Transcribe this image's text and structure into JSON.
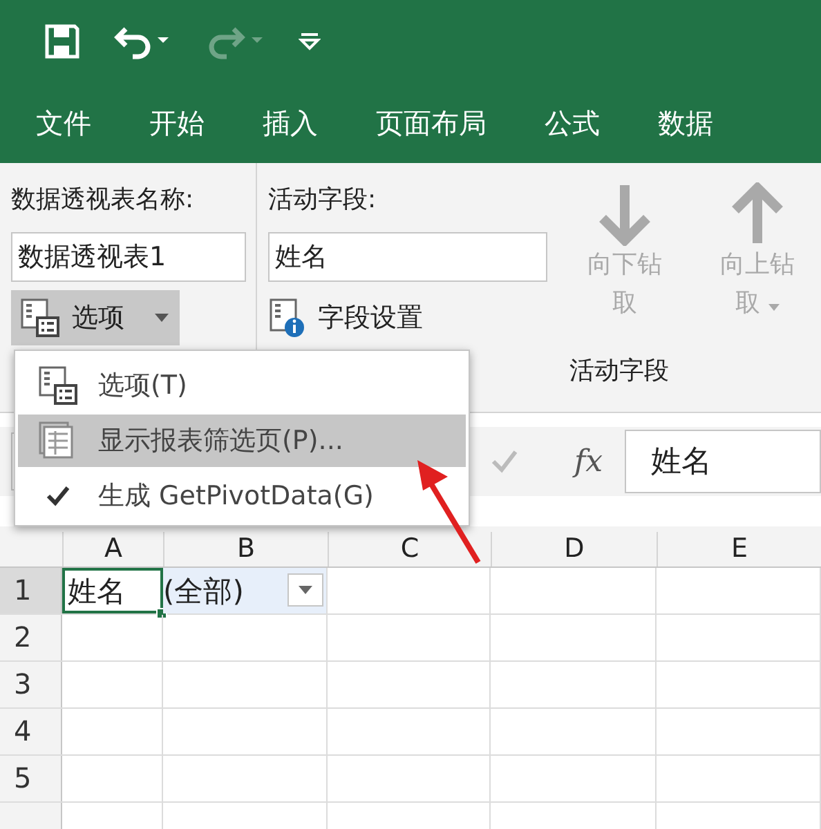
{
  "quick_access": [
    {
      "kind": "save",
      "disabled": false
    },
    {
      "kind": "undo",
      "disabled": false
    },
    {
      "kind": "redo",
      "disabled": true
    },
    {
      "kind": "customize",
      "disabled": false
    }
  ],
  "tabs": [
    {
      "label": "文件",
      "selected": false
    },
    {
      "label": "开始",
      "selected": false
    },
    {
      "label": "插入",
      "selected": false
    },
    {
      "label": "页面布局",
      "selected": false
    },
    {
      "label": "公式",
      "selected": false
    },
    {
      "label": "数据",
      "selected": false
    }
  ],
  "ribbon": {
    "pivot_name": {
      "label": "数据透视表名称:",
      "value": "数据透视表1"
    },
    "options_button": {
      "label": "选项",
      "pressed": true
    },
    "active_field": {
      "label": "活动字段:",
      "value": "姓名",
      "settings_button": "字段设置",
      "group_label": "活动字段"
    },
    "drill_buttons": [
      {
        "kind": "down",
        "label": "向下钻取",
        "disabled": true
      },
      {
        "kind": "up",
        "label": "向上钻取",
        "disabled": true
      }
    ]
  },
  "menu": {
    "items": [
      {
        "kind": "options",
        "label": "选项(T)",
        "selected": false,
        "checked": false
      },
      {
        "kind": "filter_pages",
        "label": "显示报表筛选页(P)...",
        "selected": true,
        "checked": false
      },
      {
        "kind": "getpivotdata",
        "label": "生成 GetPivotData(G)",
        "selected": false,
        "checked": true
      }
    ]
  },
  "formula_bar": {
    "fx": "fx",
    "value": "姓名"
  },
  "sheet": {
    "columns": [
      "A",
      "B",
      "C",
      "D",
      "E"
    ],
    "rows": [
      {
        "header": "1",
        "cells": [
          {
            "text": "姓名",
            "selected": true,
            "filter": false
          },
          {
            "text": "(全部)",
            "selected": false,
            "filter": true
          }
        ]
      },
      {
        "header": "2",
        "cells": []
      },
      {
        "header": "3",
        "cells": []
      },
      {
        "header": "4",
        "cells": []
      },
      {
        "header": "5",
        "cells": []
      }
    ]
  }
}
